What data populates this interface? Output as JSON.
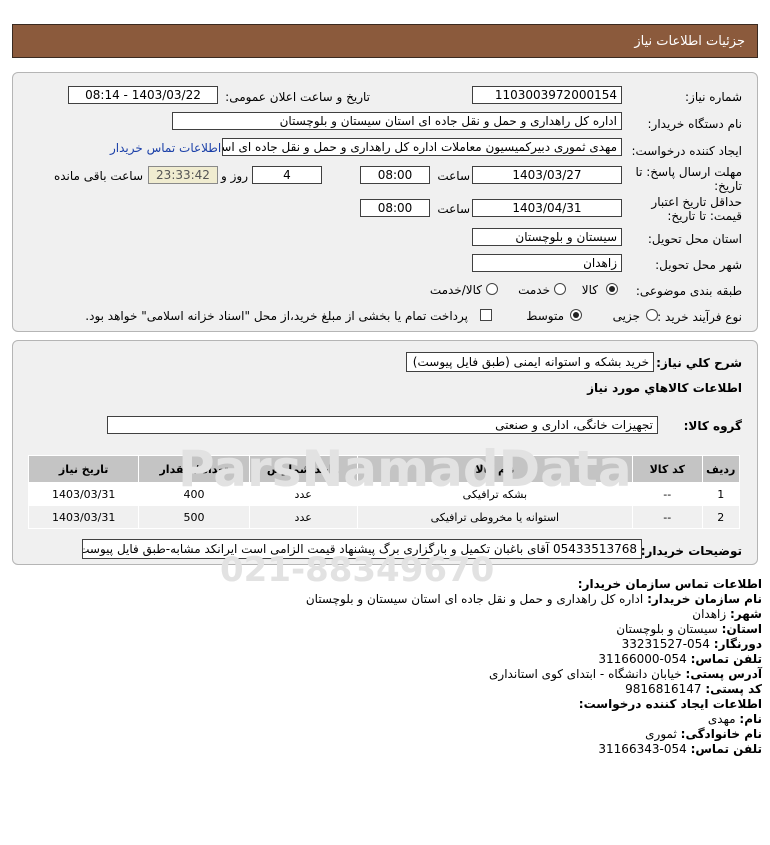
{
  "header": {
    "title": "جزئیات اطلاعات نیاز"
  },
  "form": {
    "need_number": {
      "label": "شماره نیاز:",
      "value": "1103003972000154"
    },
    "announce": {
      "label": "تاریخ و ساعت اعلان عمومی:",
      "value": "1403/03/22 - 08:14"
    },
    "buyer_org": {
      "label": "نام دستگاه خریدار:",
      "value": "اداره کل راهداری و حمل و نقل جاده ای استان سیستان و بلوچستان"
    },
    "creator": {
      "label": "ایجاد کننده درخواست:",
      "value": "مهدی ثموری دبیرکمیسیون معاملات اداره کل راهداری و حمل و نقل جاده ای استان",
      "contact_link": "اطلاعات تماس خریدار"
    },
    "deadline": {
      "label1": "مهلت ارسال پاسخ: تا",
      "label2": "تاریخ:",
      "date": "1403/03/27",
      "time_label": "ساعت",
      "time": "08:00",
      "days": "4",
      "days_label": "روز و",
      "remaining": "23:33:42",
      "remaining_label": "ساعت باقی مانده"
    },
    "validity": {
      "label1": "حداقل تاریخ اعتبار",
      "label2": "قیمت: تا تاریخ:",
      "date": "1403/04/31",
      "time_label": "ساعت",
      "time": "08:00"
    },
    "province": {
      "label": "استان محل تحویل:",
      "value": "سیستان و بلوچستان"
    },
    "city": {
      "label": "شهر محل تحویل:",
      "value": "زاهدان"
    },
    "category": {
      "label": "طبقه بندی موضوعی:",
      "options": [
        "کالا",
        "خدمت",
        "کالا/خدمت"
      ],
      "selected": "کالا"
    },
    "process": {
      "label": "نوع فرآیند خرید :",
      "options": [
        "جزیی",
        "متوسط"
      ],
      "selected": "متوسط",
      "note": "پرداخت تمام یا بخشی از مبلغ خرید،از محل \"اسناد خزانه اسلامی\" خواهد بود."
    }
  },
  "details": {
    "summary_label": "شرح کلي نياز:",
    "summary": "خرید بشکه و استوانه ایمنی (طبق فایل پیوست)",
    "goods_title": "اطلاعات کالاهاي مورد نياز",
    "group_label": "گروه کالا:",
    "group": "تجهیزات خانگی، اداری و صنعتی",
    "table": {
      "headers": [
        "ردیف",
        "کد کالا",
        "نام کالا",
        "واحد شمارش",
        "تعداد / مقدار",
        "تاریخ نیاز"
      ],
      "rows": [
        [
          "1",
          "--",
          "بشکه ترافیکی",
          "عدد",
          "400",
          "1403/03/31"
        ],
        [
          "2",
          "--",
          "استوانه یا مخروطی ترافیکی",
          "عدد",
          "500",
          "1403/03/31"
        ]
      ]
    },
    "buyer_notes_label": "توضیحات خریدار:",
    "buyer_notes": "05433513768 آقای باغبان تکمیل و بارگزاری برگ پیشنهاد قیمت الزامی است ایرانکد مشابه-طبق فایل پیوست"
  },
  "contact": {
    "title": "اطلاعات تماس سازمان خریدار:",
    "buyer_name": {
      "k": "نام سازمان خریدار:",
      "v": "اداره کل راهداری و حمل و نقل جاده ای استان سیستان و بلوچستان"
    },
    "city": {
      "k": "شهر:",
      "v": "زاهدان"
    },
    "province": {
      "k": "استان:",
      "v": "سیستان و بلوچستان"
    },
    "fax": {
      "k": "دورنگار:",
      "v": "054-33231527"
    },
    "phone": {
      "k": "تلفن تماس:",
      "v": "054-31166000"
    },
    "address": {
      "k": "آدرس پستی:",
      "v": "خیابان دانشگاه - ابتدای کوی استانداری"
    },
    "postal": {
      "k": "کد پستی:",
      "v": "9816816147"
    },
    "creator_title": "اطلاعات ایجاد کننده درخواست:",
    "first_name": {
      "k": "نام:",
      "v": "مهدی"
    },
    "last_name": {
      "k": "نام خانوادگی:",
      "v": "ثموری"
    },
    "creator_phone": {
      "k": "تلفن تماس:",
      "v": "054-31166343"
    }
  },
  "watermark": {
    "brand": "ParsNamadData",
    "number": "021-88349670"
  }
}
